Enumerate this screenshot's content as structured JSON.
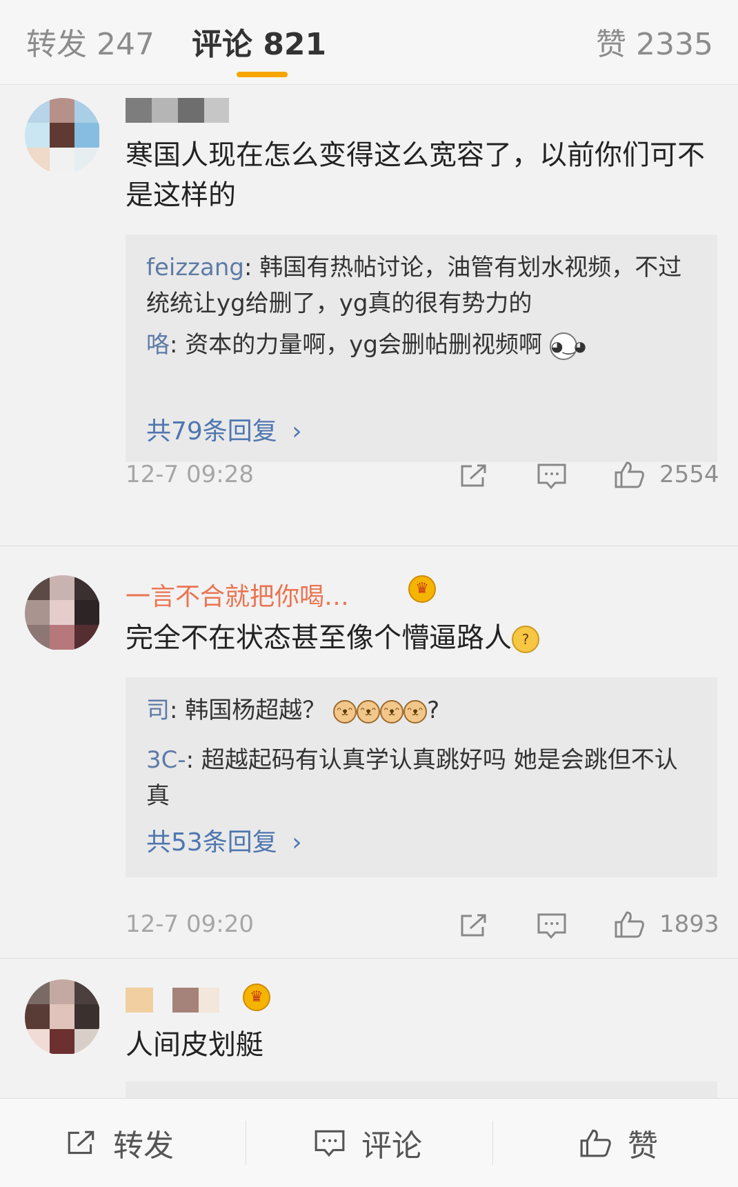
{
  "tabs": {
    "reposts": "转发 247",
    "comments": "评论 821",
    "likes": "赞 2335"
  },
  "comments": [
    {
      "text": "寒国人现在怎么变得这么宽容了，以前你们可不是这样的",
      "replies": [
        {
          "name": "feizzang",
          "text": ": 韩国有热帖讨论，油管有划水视频，不过统统让yg给删了，yg真的很有势力的"
        },
        {
          "name": "咯",
          "text": ": 资本的力量啊，yg会删帖删视频啊"
        }
      ],
      "total": "共79条回复",
      "time": "12-7 09:28",
      "likes": "2554"
    },
    {
      "username": "一言不合就把你喝…",
      "text": "完全不在状态甚至像个懵逼路人",
      "replies": [
        {
          "name": "司",
          "text": ": 韩国杨超越？"
        },
        {
          "name": "3C-",
          "text": ": 超越起码有认真学认真跳好吗  她是会跳但不认真"
        }
      ],
      "total": "共53条回复",
      "time": "12-7 09:20",
      "likes": "1893"
    },
    {
      "text": "人间皮划艇"
    }
  ],
  "bottom_bar": {
    "repost": "转发",
    "comment": "评论",
    "like": "赞"
  },
  "colors": {
    "accent_underline": "#f7a500",
    "link_blue": "#4f76b0",
    "username_orange": "#eb7350"
  }
}
